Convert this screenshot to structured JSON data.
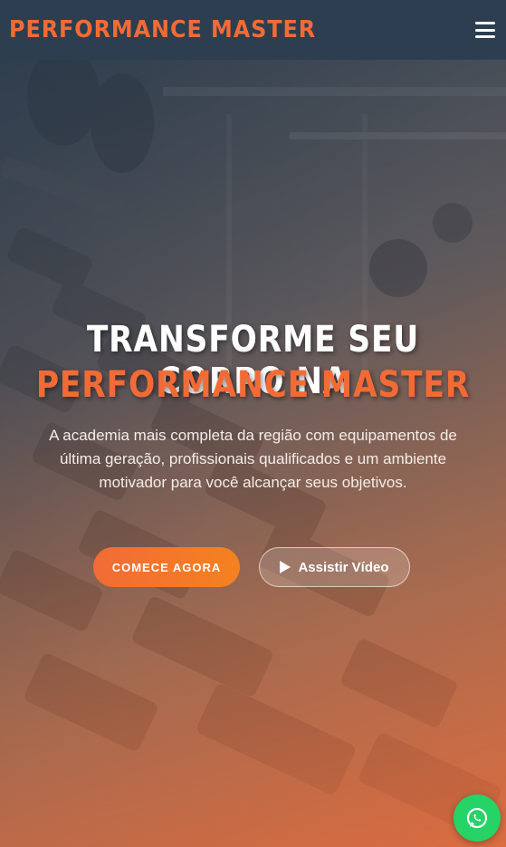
{
  "header": {
    "logo_text": "PERFORMANCE MASTER",
    "menu_icon": "hamburger-menu-icon"
  },
  "hero": {
    "title_line1": "TRANSFORME SEU CORPO NA",
    "title_line2": "PERFORMANCE MASTER",
    "subtitle": "A academia mais completa da região com equipamentos de última geração, profissionais qualificados e um ambiente motivador para você alcançar seus objetivos.",
    "primary_button": "COMECE AGORA",
    "secondary_button": "Assistir Vídeo",
    "secondary_icon": "play-icon"
  },
  "floating": {
    "whatsapp_icon": "whatsapp-icon"
  },
  "colors": {
    "header_bg": "#2c3e50",
    "accent": "#f26b36",
    "whatsapp": "#25d366"
  }
}
